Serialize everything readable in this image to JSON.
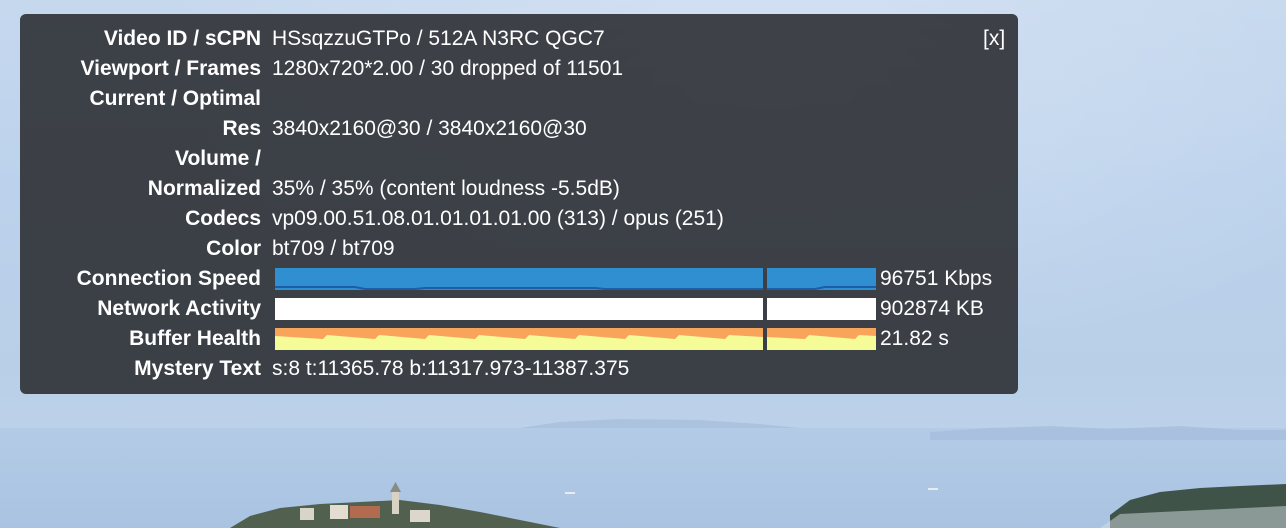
{
  "close_label": "[x]",
  "stats": {
    "video_id": {
      "label": "Video ID / sCPN",
      "value": "HSsqzzuGTPo / 512A N3RC QGC7"
    },
    "viewport": {
      "label": "Viewport / Frames",
      "value": "1280x720*2.00 / 30 dropped of 11501"
    },
    "current_optimal": {
      "label": "Current / Optimal"
    },
    "res": {
      "label": "Res",
      "value": "3840x2160@30 / 3840x2160@30"
    },
    "volume": {
      "label": "Volume /"
    },
    "normalized": {
      "label": "Normalized",
      "value": "35% / 35% (content loudness -5.5dB)"
    },
    "codecs": {
      "label": "Codecs",
      "value": "vp09.00.51.08.01.01.01.01.00 (313) / opus (251)"
    },
    "color": {
      "label": "Color",
      "value": "bt709 / bt709"
    },
    "connection_speed": {
      "label": "Connection Speed",
      "value": "96751 Kbps"
    },
    "network_activity": {
      "label": "Network Activity",
      "value": "902874 KB"
    },
    "buffer_health": {
      "label": "Buffer Health",
      "value": "21.82 s"
    },
    "mystery_text": {
      "label": "Mystery Text",
      "value": "s:8 t:11365.78 b:11317.973-11387.375"
    }
  },
  "colors": {
    "panel_bg": "#2e3034",
    "connection_fill": "#2f8fd0",
    "connection_line": "#1a5ea8",
    "network_fill": "#ffffff",
    "buffer_fill": "#f4fb97",
    "buffer_top": "#f8a55b"
  }
}
